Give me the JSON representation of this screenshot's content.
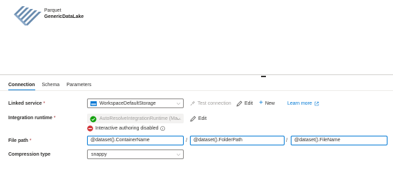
{
  "dataset": {
    "type_label": "Parquet",
    "name": "GenericDataLake"
  },
  "tabs": [
    {
      "label": "Connection",
      "active": true
    },
    {
      "label": "Schema",
      "active": false
    },
    {
      "label": "Parameters",
      "active": false
    }
  ],
  "linked_service": {
    "label": "Linked service",
    "required_mark": "*",
    "value": "WorkspaceDefaultStorage",
    "test_connection": "Test connection",
    "edit": "Edit",
    "new": "New",
    "learn_more": "Learn more"
  },
  "integration_runtime": {
    "label": "Integration runtime",
    "required_mark": "*",
    "value": "AutoResolveIntegrationRuntime (Ma...",
    "edit": "Edit",
    "status": "Interactive authoring disabled"
  },
  "file_path": {
    "label": "File path",
    "required_mark": "*",
    "container": "@dataset().ContainerName",
    "folder": "@dataset().FolderPath",
    "file": "@dataset().FileName",
    "separator": "/"
  },
  "compression": {
    "label": "Compression type",
    "value": "snappy"
  },
  "colors": {
    "accent": "#0078d4",
    "success": "#13a10e",
    "error": "#d13438",
    "required": "#a4262c"
  }
}
